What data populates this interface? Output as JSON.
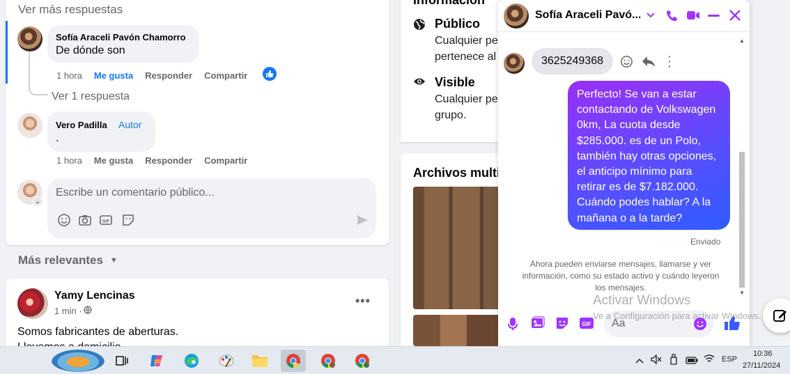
{
  "post": {
    "see_more_replies": "Ver más respuestas",
    "reply1": {
      "author": "Sofía Araceli Pavón Chamorro",
      "text": "De dónde son",
      "time": "1 hora",
      "like": "Me gusta",
      "reply": "Responder",
      "share": "Compartir"
    },
    "see_one_reply": "Ver 1 respuesta",
    "comment2": {
      "author": "Vero Padilla",
      "badge": "Autor",
      "text": ".",
      "time": "1 hora",
      "like": "Me gusta",
      "reply": "Responder",
      "share": "Compartir"
    },
    "comment_input_placeholder": "Escribe un comentario público..."
  },
  "sort_label": "Más relevantes",
  "next_post": {
    "author": "Yamy Lencinas",
    "time": "1 min · ",
    "text": "Somos fabricantes de aberturas.",
    "text2": "Llevamos a domicilio"
  },
  "group_info": {
    "header": "Información",
    "public_title": "Público",
    "public_desc1": "Cualquier pe",
    "public_desc2": "pertenece al",
    "visible_title": "Visible",
    "visible_desc1": "Cualquier pe",
    "visible_desc2": "grupo."
  },
  "media": {
    "header": "Archivos multi"
  },
  "chat": {
    "contact_name": "Sofía Araceli Pavó...",
    "incoming_message": "3625249368",
    "outgoing_message": "Perfecto!  Se van a estar contactando de Volkswagen 0km, La cuota desde $285.000. es de un Polo, también hay otras opciones, el anticipo mínimo para retirar es de $7.182.000. Cuándo podes hablar? A la mañana o a la tarde?",
    "status": "Enviado",
    "info_notice": "Ahora pueden enviarse mensajes, llamarse y ver información, como su estado activo y cuándo leyeron los mensajes.",
    "input_placeholder": "Aa",
    "accent_color": "#a033ff"
  },
  "watermark": {
    "line1": "Activar Windows",
    "line2": "Ve a Configuración para activar Windows."
  },
  "taskbar": {
    "lang": "ESP",
    "time": "10:36",
    "date": "27/11/2024"
  }
}
